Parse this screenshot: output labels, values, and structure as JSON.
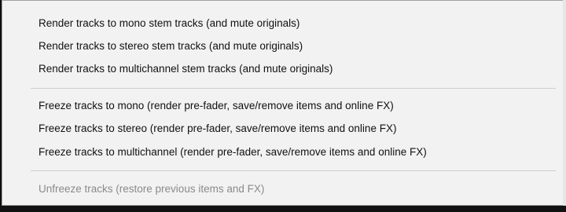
{
  "menu": {
    "items": [
      {
        "label": "Render tracks to mono stem tracks (and mute originals)",
        "enabled": true
      },
      {
        "label": "Render tracks to stereo stem tracks (and mute originals)",
        "enabled": true
      },
      {
        "label": "Render tracks to multichannel stem tracks (and mute originals)",
        "enabled": true
      },
      {
        "label": "Freeze tracks to mono (render pre-fader, save/remove items and online FX)",
        "enabled": true
      },
      {
        "label": "Freeze tracks to stereo (render pre-fader, save/remove items and online FX)",
        "enabled": true
      },
      {
        "label": "Freeze tracks to multichannel (render pre-fader, save/remove items and online FX)",
        "enabled": true
      },
      {
        "label": "Unfreeze tracks (restore previous items and FX)",
        "enabled": false
      }
    ]
  }
}
